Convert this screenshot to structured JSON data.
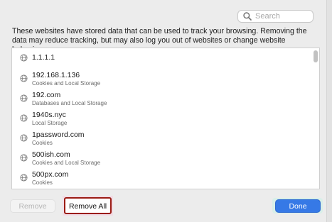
{
  "search": {
    "placeholder": "Search"
  },
  "description": "These websites have stored data that can be used to track your browsing. Removing the data may reduce tracking, but may also log you out of websites or change website behavior.",
  "websites": [
    {
      "name": "1.1.1.1",
      "detail": ""
    },
    {
      "name": "192.168.1.136",
      "detail": "Cookies and Local Storage"
    },
    {
      "name": "192.com",
      "detail": "Databases and Local Storage"
    },
    {
      "name": "1940s.nyc",
      "detail": "Local Storage"
    },
    {
      "name": "1password.com",
      "detail": "Cookies"
    },
    {
      "name": "500ish.com",
      "detail": "Cookies and Local Storage"
    },
    {
      "name": "500px.com",
      "detail": "Cookies"
    }
  ],
  "buttons": {
    "remove": "Remove",
    "remove_all": "Remove All",
    "done": "Done"
  },
  "colors": {
    "accent": "#3679e6",
    "remove_all_outline": "#9b1c14"
  }
}
